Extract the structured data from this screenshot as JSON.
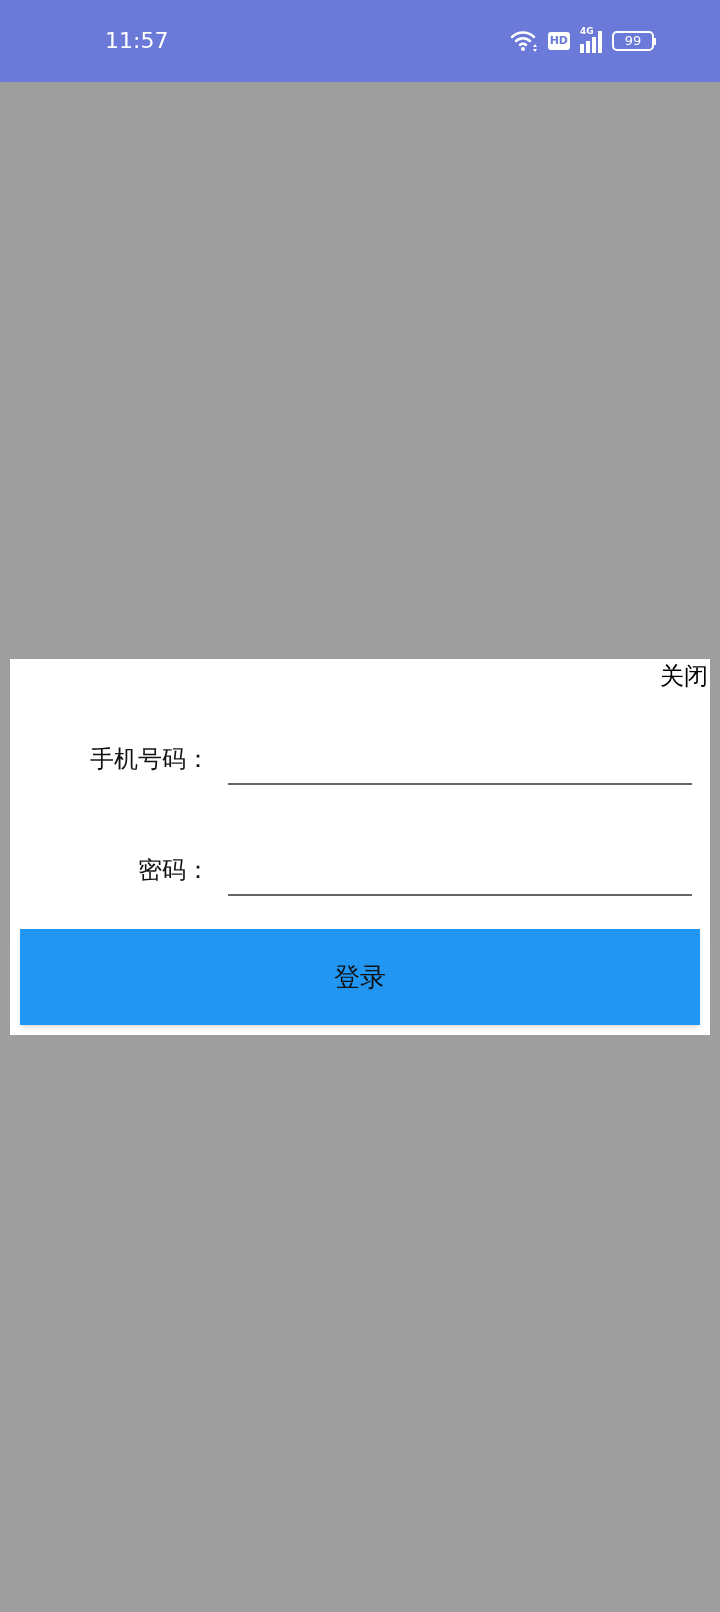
{
  "status_bar": {
    "time": "11:57",
    "hd": "HD",
    "network": "4G",
    "battery": "99"
  },
  "dialog": {
    "close": "关闭",
    "fields": [
      {
        "label": "手机号码："
      },
      {
        "label": "密码："
      }
    ],
    "submit": "登录"
  }
}
